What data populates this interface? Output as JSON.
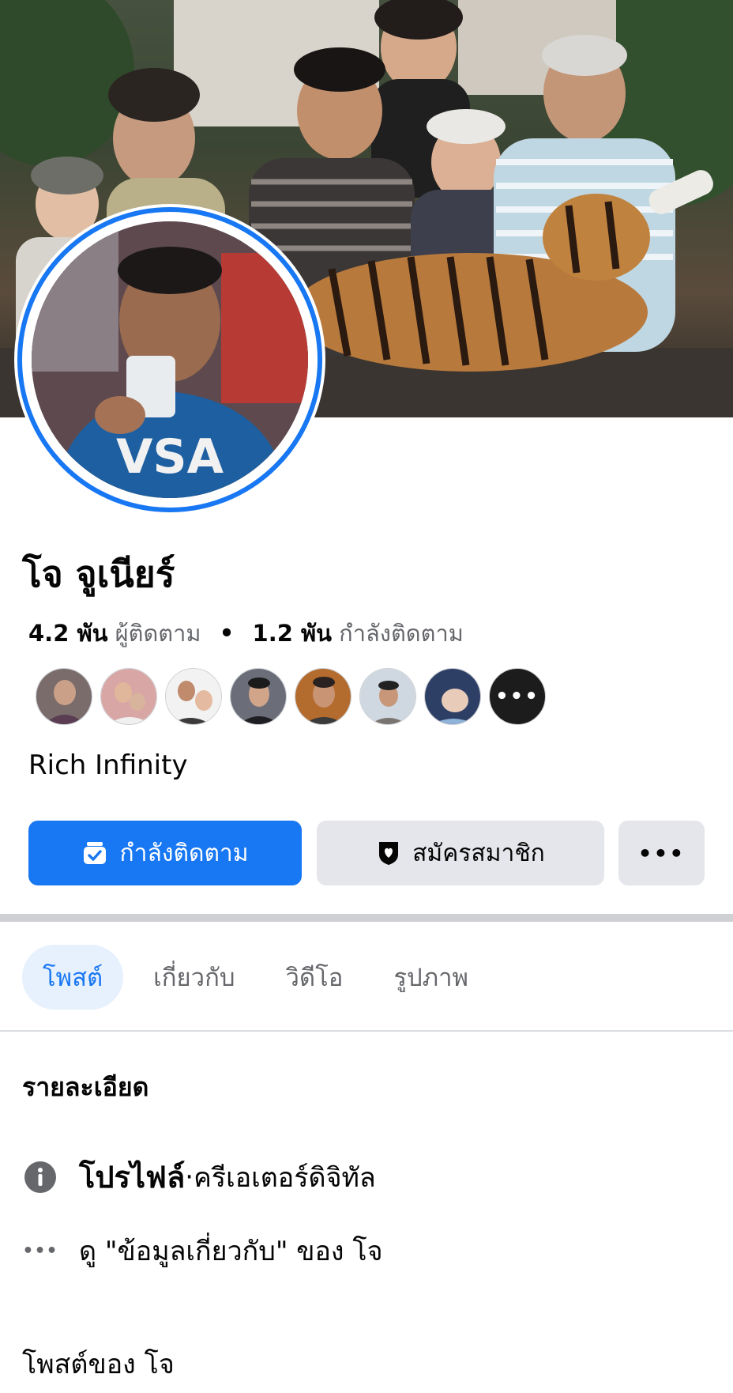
{
  "profile": {
    "name": "โจ จูเนียร์",
    "followers_count": "4.2 พัน",
    "followers_label": "ผู้ติดตาม",
    "following_count": "1.2 พัน",
    "following_label": "กำลังติดตาม",
    "bio": "Rich Infinity",
    "friends_more_label": "•••"
  },
  "actions": {
    "follow_label": "กำลังติดตาม",
    "subscribe_label": "สมัครสมาชิก",
    "more_label": "•••"
  },
  "tabs": [
    {
      "label": "โพสต์",
      "active": true
    },
    {
      "label": "เกี่ยวกับ",
      "active": false
    },
    {
      "label": "วิดีโอ",
      "active": false
    },
    {
      "label": "รูปภาพ",
      "active": false
    }
  ],
  "details": {
    "title": "รายละเอียด",
    "profile_label": "โปรไฟล์",
    "profile_separator": " · ",
    "profile_category": "ครีเอเตอร์ดิจิทัล",
    "about_more_icon": "•••",
    "about_link": "ดู \"ข้อมูลเกี่ยวกับ\" ของ โจ"
  },
  "posts_title": "โพสต์ของ โจ",
  "colors": {
    "accent": "#1877f2",
    "button_gray": "#e4e6eb",
    "tab_active_bg": "#e7f0fd",
    "secondary_text": "#65676b"
  },
  "icons": {
    "follow_button": "following-feed-icon",
    "subscribe_button": "subscribe-shield-icon",
    "profile_detail": "info-icon",
    "about_detail": "more-dots-icon"
  }
}
